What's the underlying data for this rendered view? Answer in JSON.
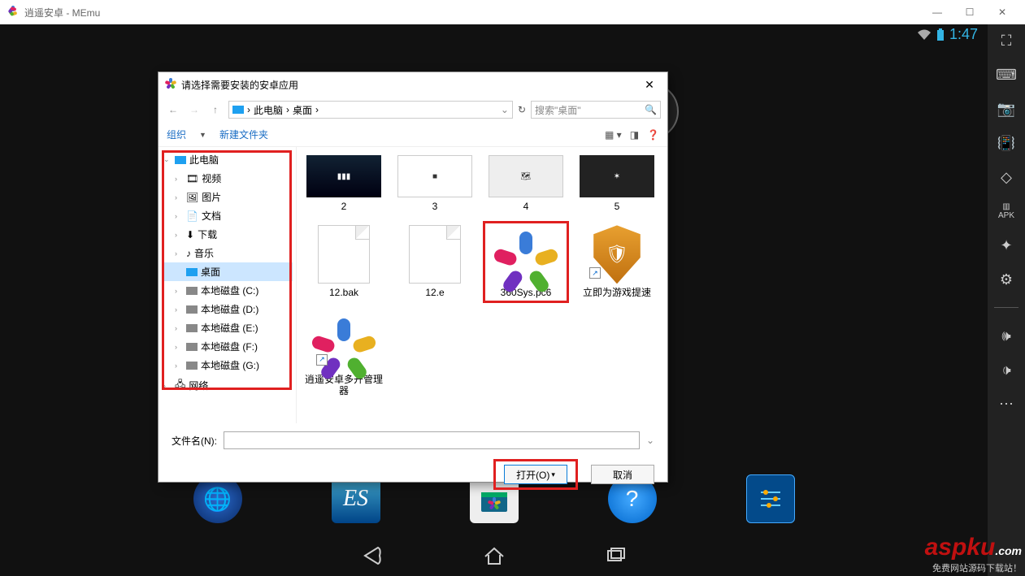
{
  "window": {
    "title": "逍遥安卓 - MEmu"
  },
  "statusbar": {
    "time": "1:47"
  },
  "sideToolbar": {
    "apk_label": "APK"
  },
  "dialog": {
    "title": "请选择需要安装的安卓应用",
    "breadcrumb": {
      "root": "此电脑",
      "current": "桌面"
    },
    "search_placeholder": "搜索\"桌面\"",
    "toolbar": {
      "organize": "组织",
      "new_folder": "新建文件夹"
    },
    "tree": {
      "root": "此电脑",
      "items": [
        "视频",
        "图片",
        "文档",
        "下载",
        "音乐",
        "桌面",
        "本地磁盘 (C:)",
        "本地磁盘 (D:)",
        "本地磁盘 (E:)",
        "本地磁盘 (F:)",
        "本地磁盘 (G:)"
      ],
      "network": "网络"
    },
    "thumbs": [
      {
        "label": "2"
      },
      {
        "label": "3"
      },
      {
        "label": "4"
      },
      {
        "label": "5"
      }
    ],
    "files": {
      "f1": "12.bak",
      "f2": "12.e",
      "f3": "360Sys.pc6",
      "f4": "立即为游戏提速",
      "f5": "逍遥安卓多开管理器"
    },
    "filename_label": "文件名(N):",
    "open": "打开(O)",
    "cancel": "取消"
  },
  "watermark": {
    "main": "aspku",
    "dot": ".com",
    "sub": "免费网站源码下载站！"
  }
}
